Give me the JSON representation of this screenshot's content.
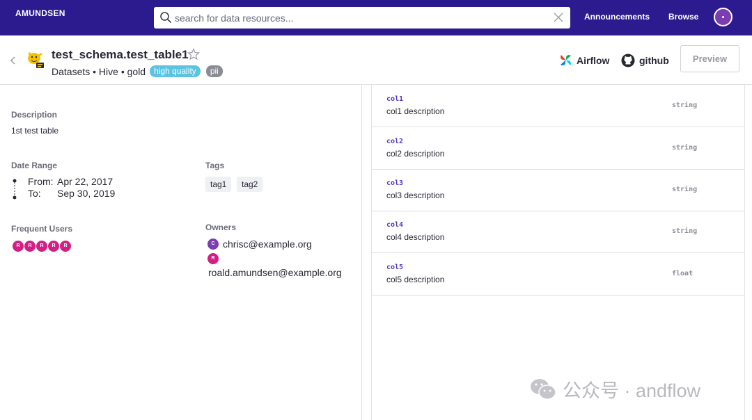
{
  "nav": {
    "logo": "AMUNDSEN",
    "search_placeholder": "search for data resources...",
    "announcements": "Announcements",
    "browse": "Browse"
  },
  "header": {
    "title": "test_schema.test_table1",
    "subtitle": "Datasets • Hive • gold",
    "badges": [
      "high quality",
      "pii"
    ],
    "links": {
      "airflow": "Airflow",
      "github": "github"
    },
    "preview": "Preview"
  },
  "details": {
    "description_title": "Description",
    "description": "1st test table",
    "date_range_title": "Date Range",
    "from_label": "From:",
    "from_value": "Apr 22, 2017",
    "to_label": "To:",
    "to_value": "Sep 30, 2019",
    "tags_title": "Tags",
    "tags": [
      "tag1",
      "tag2"
    ],
    "frequent_users_title": "Frequent Users",
    "frequent_users": [
      "R",
      "R",
      "R",
      "R",
      "R"
    ],
    "owners_title": "Owners",
    "owners": [
      {
        "initial": "C",
        "email": "chrisc@example.org",
        "color": "#7b3db0"
      },
      {
        "initial": "R",
        "email": "roald.amundsen@example.org",
        "color": "#d31f84"
      }
    ]
  },
  "columns": [
    {
      "name": "col1",
      "description": "col1 description",
      "type": "string"
    },
    {
      "name": "col2",
      "description": "col2 description",
      "type": "string"
    },
    {
      "name": "col3",
      "description": "col3 description",
      "type": "string"
    },
    {
      "name": "col4",
      "description": "col4 description",
      "type": "string"
    },
    {
      "name": "col5",
      "description": "col5 description",
      "type": "float"
    }
  ],
  "watermark": "公众号 · andflow",
  "colors": {
    "nav_bg": "#2b1b8f",
    "accent": "#4d3ac6",
    "badge_high_quality": "#5cc4e0",
    "badge_pii": "#8b8b96",
    "user_avatar": "#d31f84"
  }
}
